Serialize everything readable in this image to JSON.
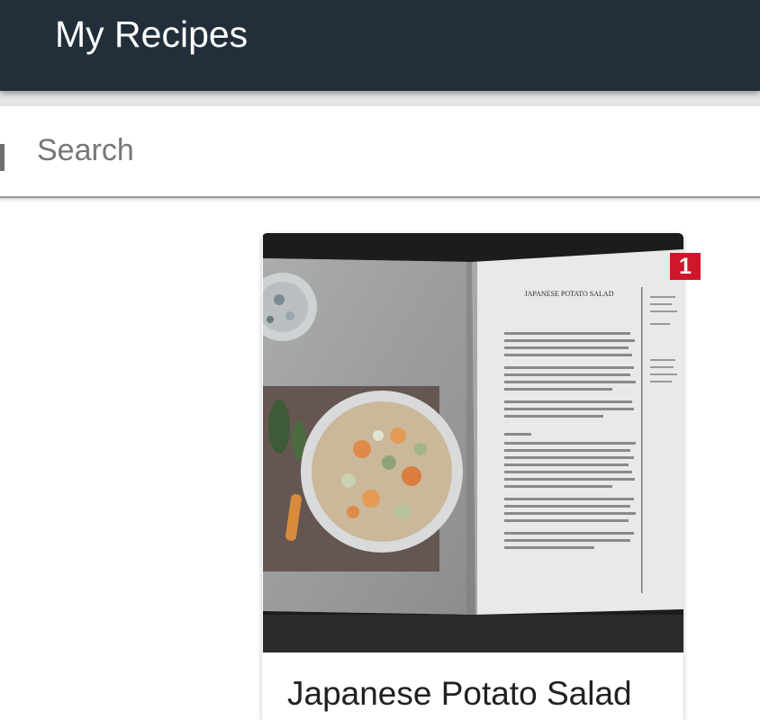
{
  "app": {
    "title": "My Recipes"
  },
  "search": {
    "placeholder": "Search",
    "value": ""
  },
  "recipes": [
    {
      "name": "Japanese Potato Salad",
      "badge": "1",
      "image_icon": "recipe-photo",
      "book_heading": "JAPANESE POTATO SALAD"
    }
  ],
  "colors": {
    "appbar": "#222f3a",
    "badge": "#d0162b",
    "background": "#ffffff"
  }
}
